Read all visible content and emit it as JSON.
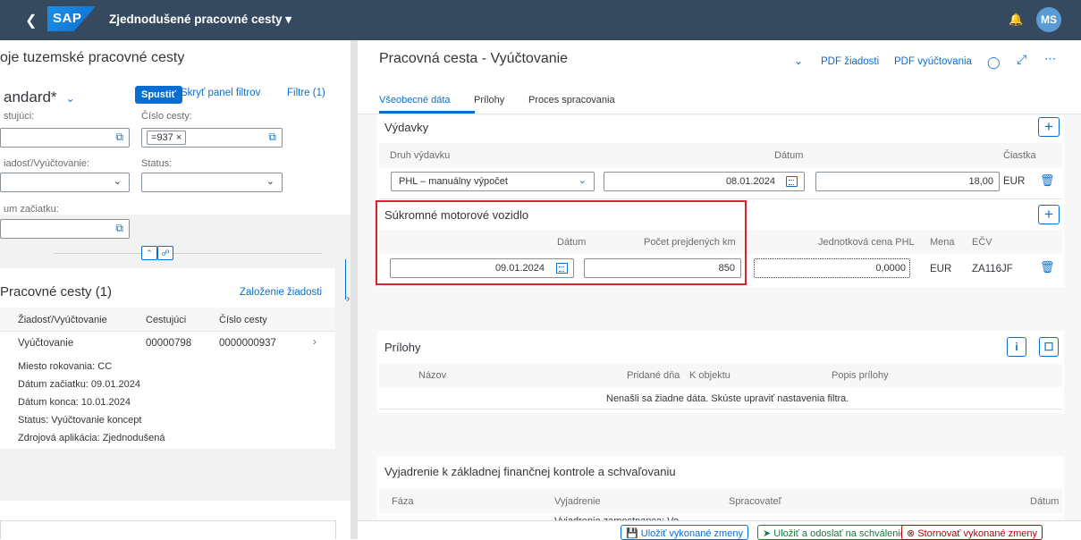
{
  "shell": {
    "title": "Zjednodušené pracovné cesty ▾",
    "logo": "SAP",
    "avatar": "MS"
  },
  "left": {
    "page_title": "oje tuzemské pracovné cesty",
    "variant": "andard*",
    "go": "Spustiť",
    "hide_filters": "Skryť panel filtrov",
    "filters": "Filtre (1)",
    "f_traveler": "stujúci:",
    "f_trip_no": "Číslo cesty:",
    "trip_token": "=937 ×",
    "f_type": "iadosť/Vyúčtovanie:",
    "f_status": "Status:",
    "f_start": "um začiatku:",
    "list_title": "Pracovné cesty (1)",
    "create": "Založenie žiadosti",
    "cols": [
      "Žiadosť/Vyúčtovanie",
      "Cestujúci",
      "Číslo cesty"
    ],
    "row": {
      "type": "Vyúčtovanie",
      "traveler": "00000798",
      "trip": "0000000937"
    },
    "details": [
      "Miesto rokovania:  CC",
      "Dátum začiatku:  09.01.2024",
      "Dátum konca:  10.01.2024",
      "Status:  Vyúčtovanie koncept",
      "Zdrojová aplikácia:  Zjednodušená"
    ]
  },
  "right": {
    "title": "Pracovná cesta - Vyúčtovanie",
    "pdf_req": "PDF žiadosti",
    "pdf_settle": "PDF vyúčtovania",
    "tabs": [
      "Všeobecné dáta",
      "Prílohy",
      "Proces spracovania"
    ],
    "exp_title": "Výdavky",
    "exp_cols": [
      "Druh výdavku",
      "Dátum",
      "Čiastka"
    ],
    "exp_row": {
      "type": "PHL – manuálny výpočet",
      "date": "08.01.2024",
      "amount": "18,00",
      "cur": "EUR"
    },
    "car_title": "Súkromné motorové vozidlo",
    "car_cols": [
      "Dátum",
      "Počet prejdených km",
      "Jednotková cena PHL",
      "Mena",
      "EČV"
    ],
    "car_row": {
      "date": "09.01.2024",
      "km": "850",
      "price": "0,0000",
      "cur": "EUR",
      "plate": "ZA116JF"
    },
    "att_title": "Prílohy",
    "att_cols": [
      "Názov",
      "Pridané dňa",
      "K objektu",
      "Popis prílohy"
    ],
    "att_empty": "Nenašli sa žiadne dáta. Skúste upraviť nastavenia filtra.",
    "ctrl_title": "Vyjadrenie k základnej finančnej kontrole a schvaľovaniu",
    "ctrl_cols": [
      "Fáza",
      "Vyjadrenie",
      "Spracovateľ",
      "Dátum"
    ],
    "ctrl_partial": "Vyjadrenie zamestnanca: Vo"
  },
  "footer": {
    "save": "Uložiť vykonané zmeny",
    "send": "Uložiť a odoslať na schválenie",
    "cancel": "Stornovať vykonané zmeny"
  }
}
